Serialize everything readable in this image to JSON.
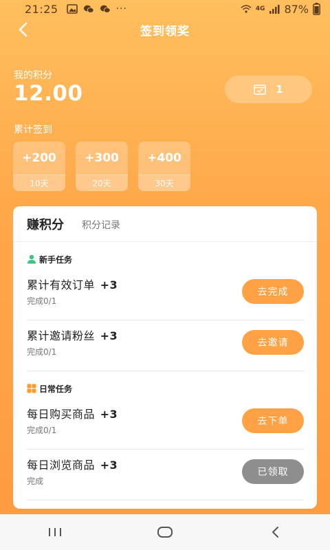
{
  "status_bar": {
    "time": "21:25",
    "battery": "87%",
    "network": "4G"
  },
  "header": {
    "title": "签到领奖"
  },
  "points": {
    "label": "我的积分",
    "value": "12.00"
  },
  "checkin": {
    "count": "1"
  },
  "accumulated": {
    "label": "累计签到",
    "milestones": [
      {
        "bonus": "+200",
        "days": "10天"
      },
      {
        "bonus": "+300",
        "days": "20天"
      },
      {
        "bonus": "+400",
        "days": "30天"
      }
    ]
  },
  "card": {
    "tab_active": "赚积分",
    "tab_records": "积分记录",
    "sections": [
      {
        "title": "新手任务",
        "tasks": [
          {
            "name": "累计有效订单",
            "plus": "+3",
            "progress": "完成0/1",
            "button": "去完成"
          },
          {
            "name": "累计邀请粉丝",
            "plus": "+3",
            "progress": "完成0/1",
            "button": "去邀请"
          }
        ]
      },
      {
        "title": "日常任务",
        "tasks": [
          {
            "name": "每日购买商品",
            "plus": "+3",
            "progress": "完成0/1",
            "button": "去下单"
          },
          {
            "name": "每日浏览商品",
            "plus": "+3",
            "progress": "完成",
            "button": "已领取"
          }
        ]
      }
    ]
  },
  "colors": {
    "accent": "#ffa245",
    "disabled": "#8e8e8e",
    "gradient_top": "#ffbf5e",
    "gradient_bottom": "#ff9a3e"
  }
}
